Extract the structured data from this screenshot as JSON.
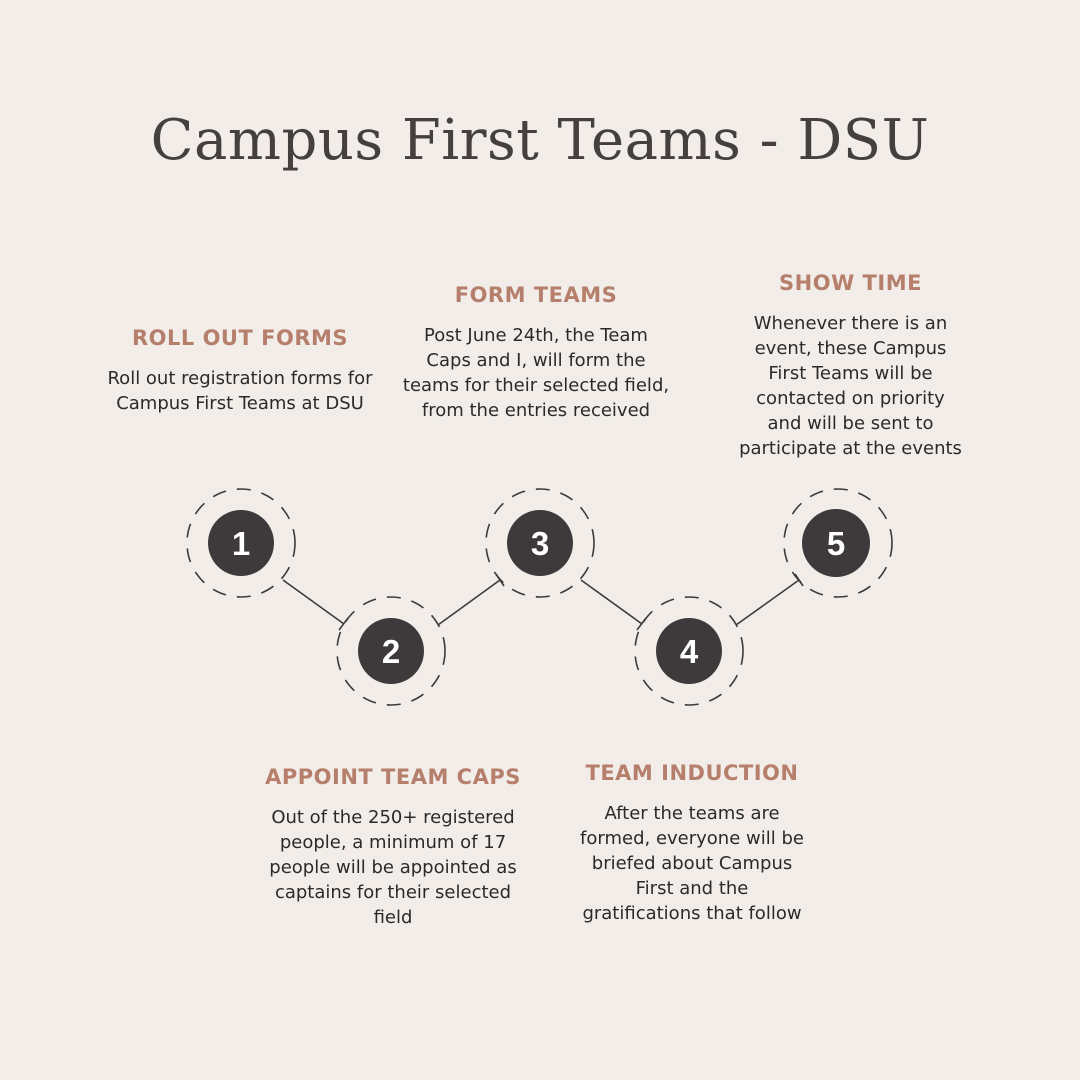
{
  "title": "Campus First Teams - DSU",
  "steps": [
    {
      "number": "1",
      "heading": "ROLL OUT FORMS",
      "description": "Roll out registration forms for Campus First Teams at DSU"
    },
    {
      "number": "2",
      "heading": "APPOINT TEAM CAPS",
      "description": "Out of the 250+ registered people, a minimum of 17 people will be appointed as captains for their selected field"
    },
    {
      "number": "3",
      "heading": "FORM TEAMS",
      "description": "Post June 24th, the Team Caps and I, will form the teams for their selected field, from the entries received"
    },
    {
      "number": "4",
      "heading": "TEAM INDUCTION",
      "description": "After the teams are formed, everyone will be briefed about Campus First and the gratifications that follow"
    },
    {
      "number": "5",
      "heading": "SHOW TIME",
      "description": "Whenever there is an event, these Campus First Teams will be contacted on priority and will be sent to participate at the events"
    }
  ],
  "colors": {
    "background": "#f2ede9",
    "heading_accent": "#b67f6c",
    "node_fill": "#3e3a3b",
    "text": "#2c2a29"
  }
}
